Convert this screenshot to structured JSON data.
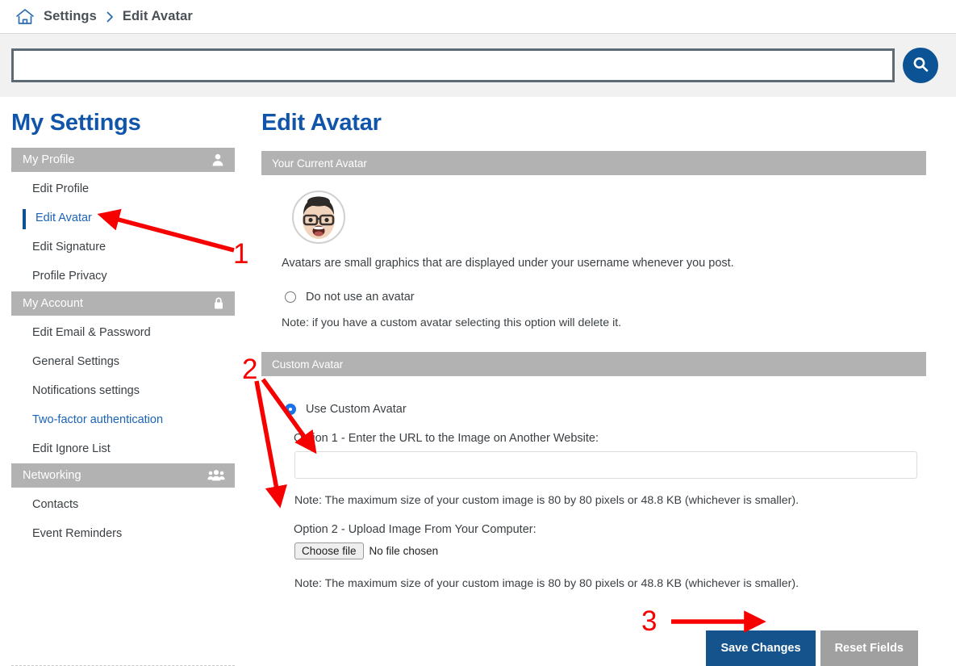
{
  "breadcrumb": {
    "home_icon": "home-icon",
    "separator_icon": "chevron-right-icon",
    "items": [
      "Settings",
      "Edit Avatar"
    ]
  },
  "search": {
    "value": "",
    "placeholder": "",
    "button_icon": "search-icon"
  },
  "sidebar": {
    "title": "My Settings",
    "groups": [
      {
        "heading": "My Profile",
        "icon": "user-icon",
        "items": [
          {
            "label": "Edit Profile",
            "state": "normal"
          },
          {
            "label": "Edit Avatar",
            "state": "active"
          },
          {
            "label": "Edit Signature",
            "state": "normal"
          },
          {
            "label": "Profile Privacy",
            "state": "normal"
          }
        ]
      },
      {
        "heading": "My Account",
        "icon": "lock-icon",
        "items": [
          {
            "label": "Edit Email & Password",
            "state": "normal"
          },
          {
            "label": "General Settings",
            "state": "normal"
          },
          {
            "label": "Notifications settings",
            "state": "normal"
          },
          {
            "label": "Two-factor authentication",
            "state": "link"
          },
          {
            "label": "Edit Ignore List",
            "state": "normal"
          }
        ]
      },
      {
        "heading": "Networking",
        "icon": "people-icon",
        "items": [
          {
            "label": "Contacts",
            "state": "normal"
          },
          {
            "label": "Event Reminders",
            "state": "normal"
          }
        ]
      }
    ]
  },
  "main": {
    "title": "Edit Avatar",
    "current_avatar_section": {
      "heading": "Your Current Avatar",
      "avatar_alt": "memoji-avatar",
      "description": "Avatars are small graphics that are displayed under your username whenever you post.",
      "no_avatar_option": {
        "label": "Do not use an avatar",
        "selected": false
      },
      "no_avatar_note": "Note: if you have a custom avatar selecting this option will delete it."
    },
    "custom_avatar_section": {
      "heading": "Custom Avatar",
      "use_custom_option": {
        "label": "Use Custom Avatar",
        "selected": true
      },
      "option1_label": "Option 1 - Enter the URL to the Image on Another Website:",
      "option1_value": "",
      "option1_placeholder": "",
      "option1_note": "Note: The maximum size of your custom image is 80 by 80 pixels or 48.8 KB (whichever is smaller).",
      "option2_label": "Option 2 - Upload Image From Your Computer:",
      "file_button_label": "Choose file",
      "file_status": "No file chosen",
      "option2_note": "Note: The maximum size of your custom image is 80 by 80 pixels or 48.8 KB (whichever is smaller)."
    },
    "buttons": {
      "save_label": "Save Changes",
      "reset_label": "Reset Fields"
    }
  },
  "annotations": {
    "color": "#f60000",
    "markers": [
      {
        "number": "1",
        "target": "sidebar-item-edit-avatar"
      },
      {
        "number": "2",
        "target": "custom-avatar-inputs"
      },
      {
        "number": "3",
        "target": "save-changes-button"
      }
    ]
  },
  "colors": {
    "brand_blue": "#1155aa",
    "button_blue": "#14538c",
    "section_gray": "#b2b2b2",
    "annotation_red": "#f60000"
  }
}
